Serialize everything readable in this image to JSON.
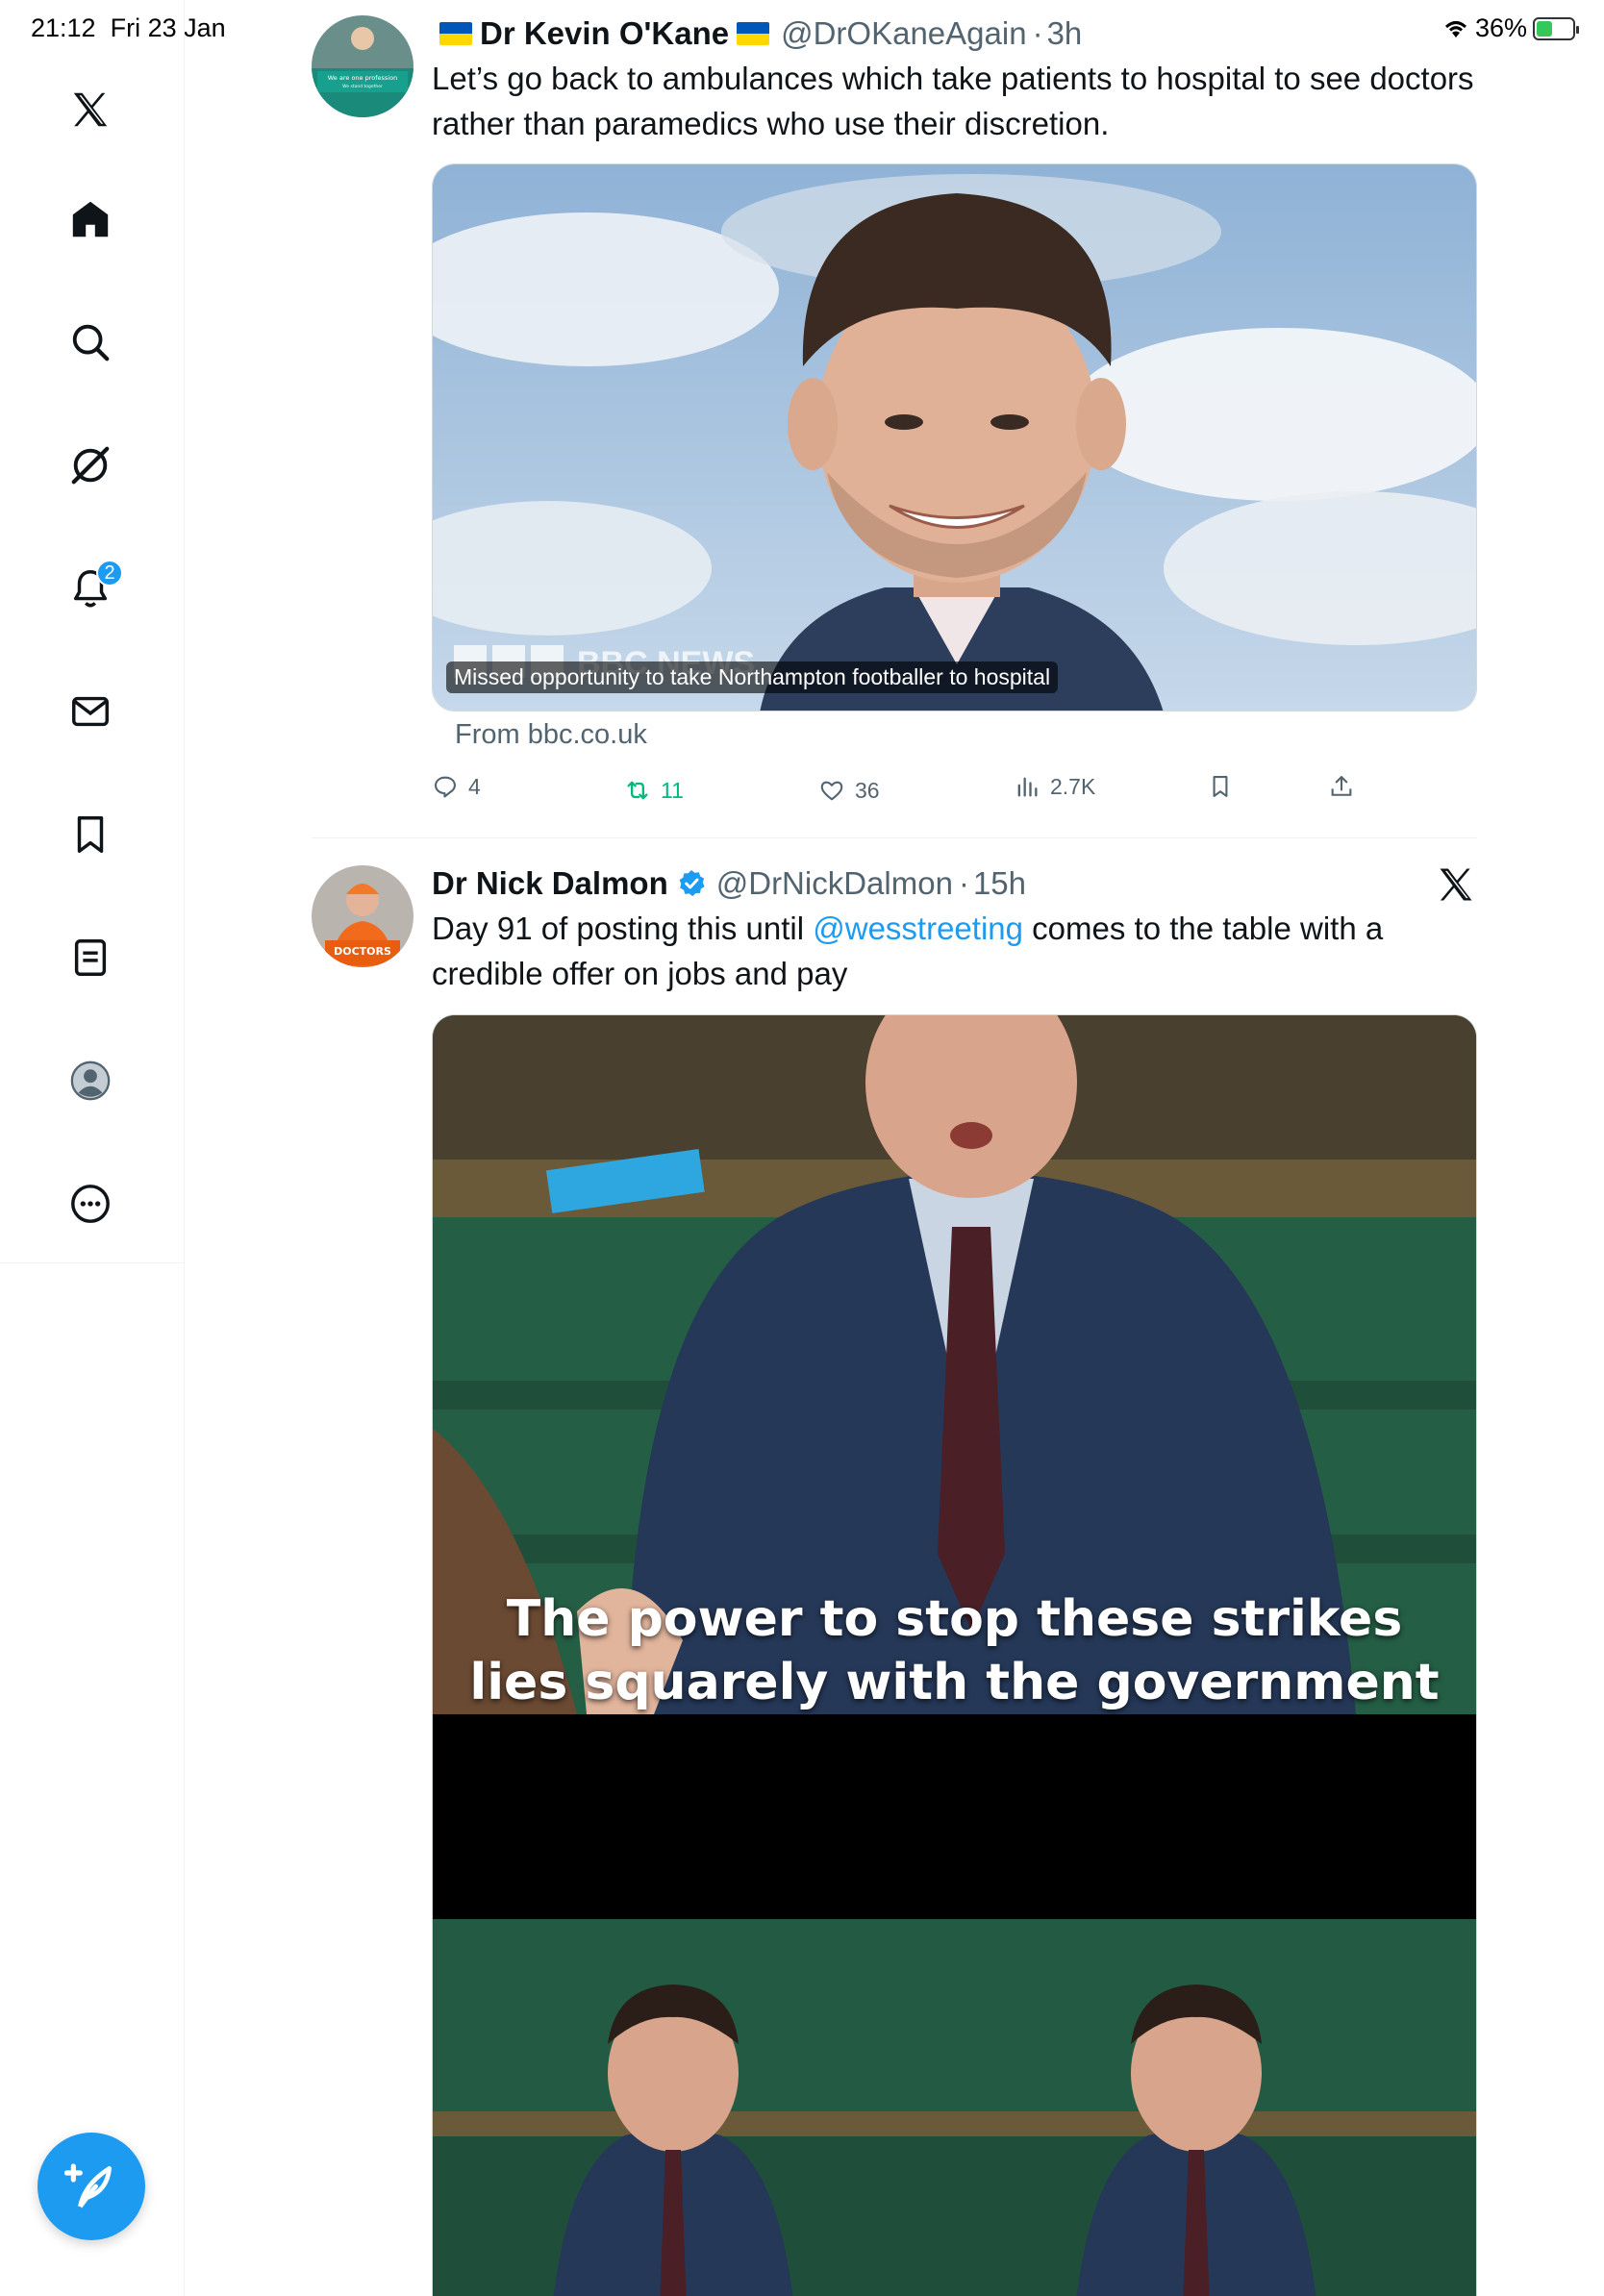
{
  "status_bar": {
    "time": "21:12",
    "date": "Fri 23 Jan",
    "battery": "36%"
  },
  "sidebar": {
    "notifications_badge": "2",
    "items": [
      {
        "name": "logo",
        "icon": "x-logo-icon"
      },
      {
        "name": "home",
        "icon": "home-icon"
      },
      {
        "name": "search",
        "icon": "search-icon"
      },
      {
        "name": "grok",
        "icon": "grok-icon"
      },
      {
        "name": "notifications",
        "icon": "bell-icon"
      },
      {
        "name": "messages",
        "icon": "mail-icon"
      },
      {
        "name": "bookmarks",
        "icon": "bookmark-icon"
      },
      {
        "name": "lists",
        "icon": "list-icon"
      },
      {
        "name": "profile",
        "icon": "avatar-icon"
      },
      {
        "name": "more",
        "icon": "more-icon"
      }
    ]
  },
  "tweets": [
    {
      "name": "Dr Kevin O'Kane",
      "handle": "@DrOKaneAgain",
      "time": "3h",
      "text": "Let’s go back to ambulances which take patients to hospital to see doctors rather than paramedics who use their discretion.",
      "media_caption": "Missed opportunity to take Northampton footballer to hospital",
      "media_watermark": "BBC NEWS",
      "link_source": "From bbc.co.uk",
      "replies": "4",
      "retweets": "11",
      "likes": "36",
      "views": "2.7K",
      "avatar_banner": "We are one profession",
      "avatar_sub": "We stand together"
    },
    {
      "name": "Dr Nick Dalmon",
      "handle": "@DrNickDalmon",
      "time": "15h",
      "text_before": "Day 91 of posting this until ",
      "mention": "@wesstreeting",
      "text_after": " comes to the table with a credible offer on jobs and pay",
      "subtitle_line1": "The power to stop these strikes",
      "subtitle_line2": "lies squarely with the government",
      "avatar_sign": "DOCTORS"
    }
  ],
  "colors": {
    "accent": "#1d9bf0",
    "retweet_active": "#00ba7c",
    "muted": "#536471"
  }
}
